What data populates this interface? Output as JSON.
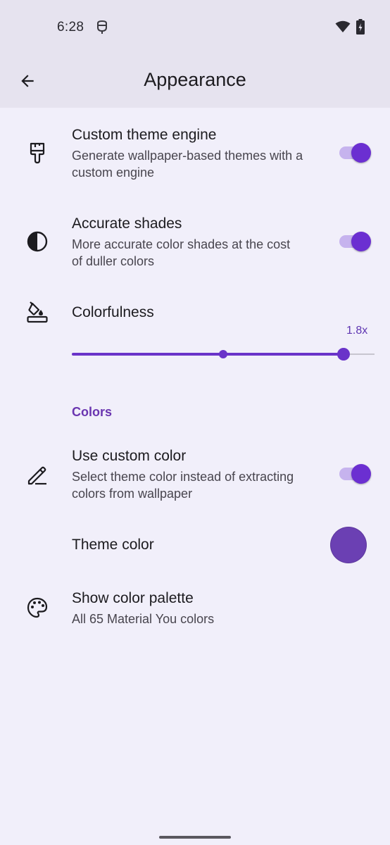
{
  "status_bar": {
    "time": "6:28",
    "icons": [
      "notification-icon",
      "wifi-icon",
      "battery-charging-icon"
    ]
  },
  "app_bar": {
    "title": "Appearance",
    "back_icon": "arrow-back-icon"
  },
  "settings": {
    "custom_theme_engine": {
      "icon": "paint-brush-icon",
      "title": "Custom theme engine",
      "subtitle": "Generate wallpaper-based themes with a custom engine",
      "enabled": true
    },
    "accurate_shades": {
      "icon": "contrast-icon",
      "title": "Accurate shades",
      "subtitle": "More accurate color shades at the cost of duller colors",
      "enabled": true
    },
    "colorfulness": {
      "icon": "format-color-fill-icon",
      "title": "Colorfulness",
      "value_label": "1.8x"
    },
    "colors_section": {
      "header": "Colors"
    },
    "use_custom_color": {
      "icon": "edit-pencil-icon",
      "title": "Use custom color",
      "subtitle": "Select theme color instead of extracting colors from wallpaper",
      "enabled": true
    },
    "theme_color": {
      "title": "Theme color",
      "color": "#6b40b3"
    },
    "show_color_palette": {
      "icon": "palette-icon",
      "title": "Show color palette",
      "subtitle": "All 65 Material You colors"
    }
  },
  "colors": {
    "background": "#f1effa",
    "app_bar": "#e6e3ef",
    "accent": "#6b2fd1",
    "switch_track": "#c6b3ee",
    "section_header": "#6a35b0"
  }
}
